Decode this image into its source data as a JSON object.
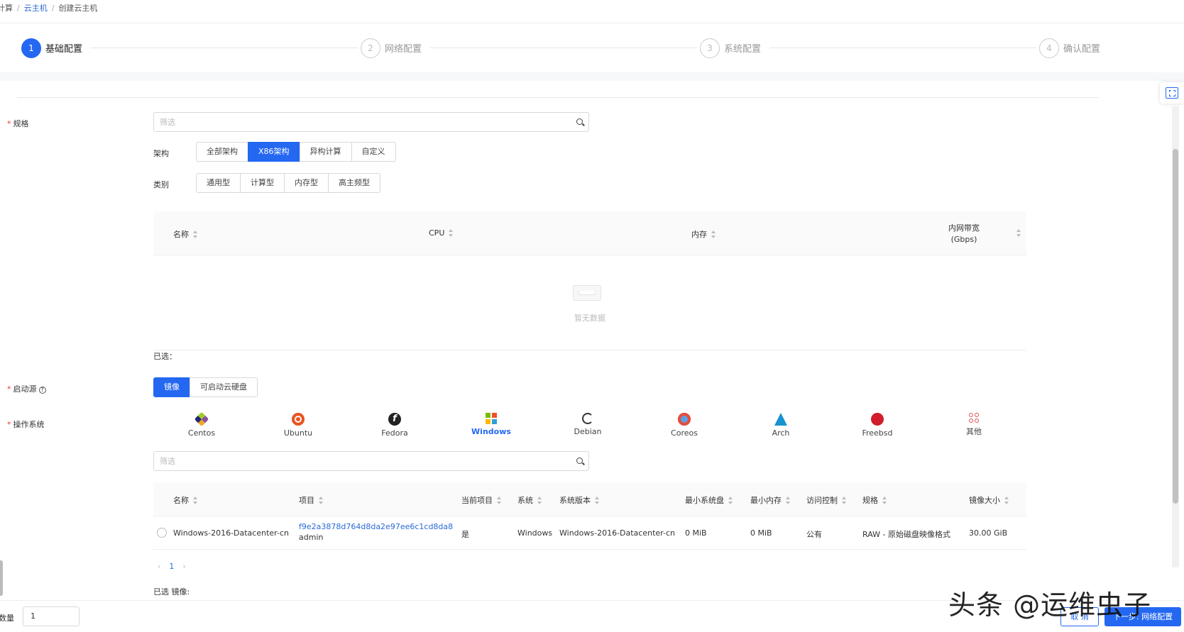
{
  "breadcrumb": {
    "root": "计算",
    "parent": "云主机",
    "current": "创建云主机"
  },
  "steps": [
    {
      "num": "1",
      "label": "基础配置"
    },
    {
      "num": "2",
      "label": "网络配置"
    },
    {
      "num": "3",
      "label": "系统配置"
    },
    {
      "num": "4",
      "label": "确认配置"
    }
  ],
  "spec": {
    "label": "规格",
    "filter_placeholder": "筛选",
    "arch_label": "架构",
    "arch_options": [
      "全部架构",
      "X86架构",
      "异构计算",
      "自定义"
    ],
    "arch_selected": "X86架构",
    "category_label": "类别",
    "category_options": [
      "通用型",
      "计算型",
      "内存型",
      "高主频型"
    ],
    "table_headers": {
      "name": "名称",
      "cpu": "CPU",
      "memory": "内存",
      "bandwidth": "内网带宽",
      "bandwidth_unit": "(Gbps)"
    },
    "empty_text": "暂无数据",
    "selected_label": "已选："
  },
  "boot": {
    "label": "启动源",
    "help": "?",
    "options": [
      "镜像",
      "可启动云硬盘"
    ],
    "selected": "镜像"
  },
  "os": {
    "label": "操作系统",
    "items": [
      {
        "name": "Centos",
        "icon": "centos-icon",
        "color": "#8a4ea0"
      },
      {
        "name": "Ubuntu",
        "icon": "ubuntu-icon",
        "color": "#e95420"
      },
      {
        "name": "Fedora",
        "icon": "fedora-icon",
        "color": "#222222"
      },
      {
        "name": "Windows",
        "icon": "windows-icon",
        "color": "#2468f2"
      },
      {
        "name": "Debian",
        "icon": "debian-icon",
        "color": "#333333"
      },
      {
        "name": "Coreos",
        "icon": "coreos-icon",
        "color": "#e74c3c"
      },
      {
        "name": "Arch",
        "icon": "arch-icon",
        "color": "#1793d1"
      },
      {
        "name": "Freebsd",
        "icon": "freebsd-icon",
        "color": "#d01f2a"
      },
      {
        "name": "其他",
        "icon": "other-icon",
        "color": "#e05a5a"
      }
    ],
    "selected": "Windows",
    "filter_placeholder": "筛选"
  },
  "image_table": {
    "headers": [
      "名称",
      "项目",
      "当前项目",
      "系统",
      "系统版本",
      "最小系统盘",
      "最小内存",
      "访问控制",
      "规格",
      "镜像大小"
    ],
    "rows": [
      {
        "name": "Windows-2016-Datacenter-cn",
        "project_id": "f9e2a3878d764d8da2e97ee6c1cd8da8",
        "project_name": "admin",
        "current": "是",
        "system": "Windows",
        "version": "Windows-2016-Datacenter-cn",
        "min_disk": "0 MiB",
        "min_mem": "0 MiB",
        "access": "公有",
        "format": "RAW - 原始磁盘映像格式",
        "size": "30.00 GiB"
      }
    ],
    "page": "1",
    "selected_label": "已选 镜像:"
  },
  "footer": {
    "qty_label": "数量",
    "qty_value": "1",
    "cancel": "取 消",
    "next": "下一步: 网络配置"
  },
  "watermark": "头条 @运维虫子",
  "colors": {
    "primary": "#2468f2",
    "required": "#e33333"
  }
}
